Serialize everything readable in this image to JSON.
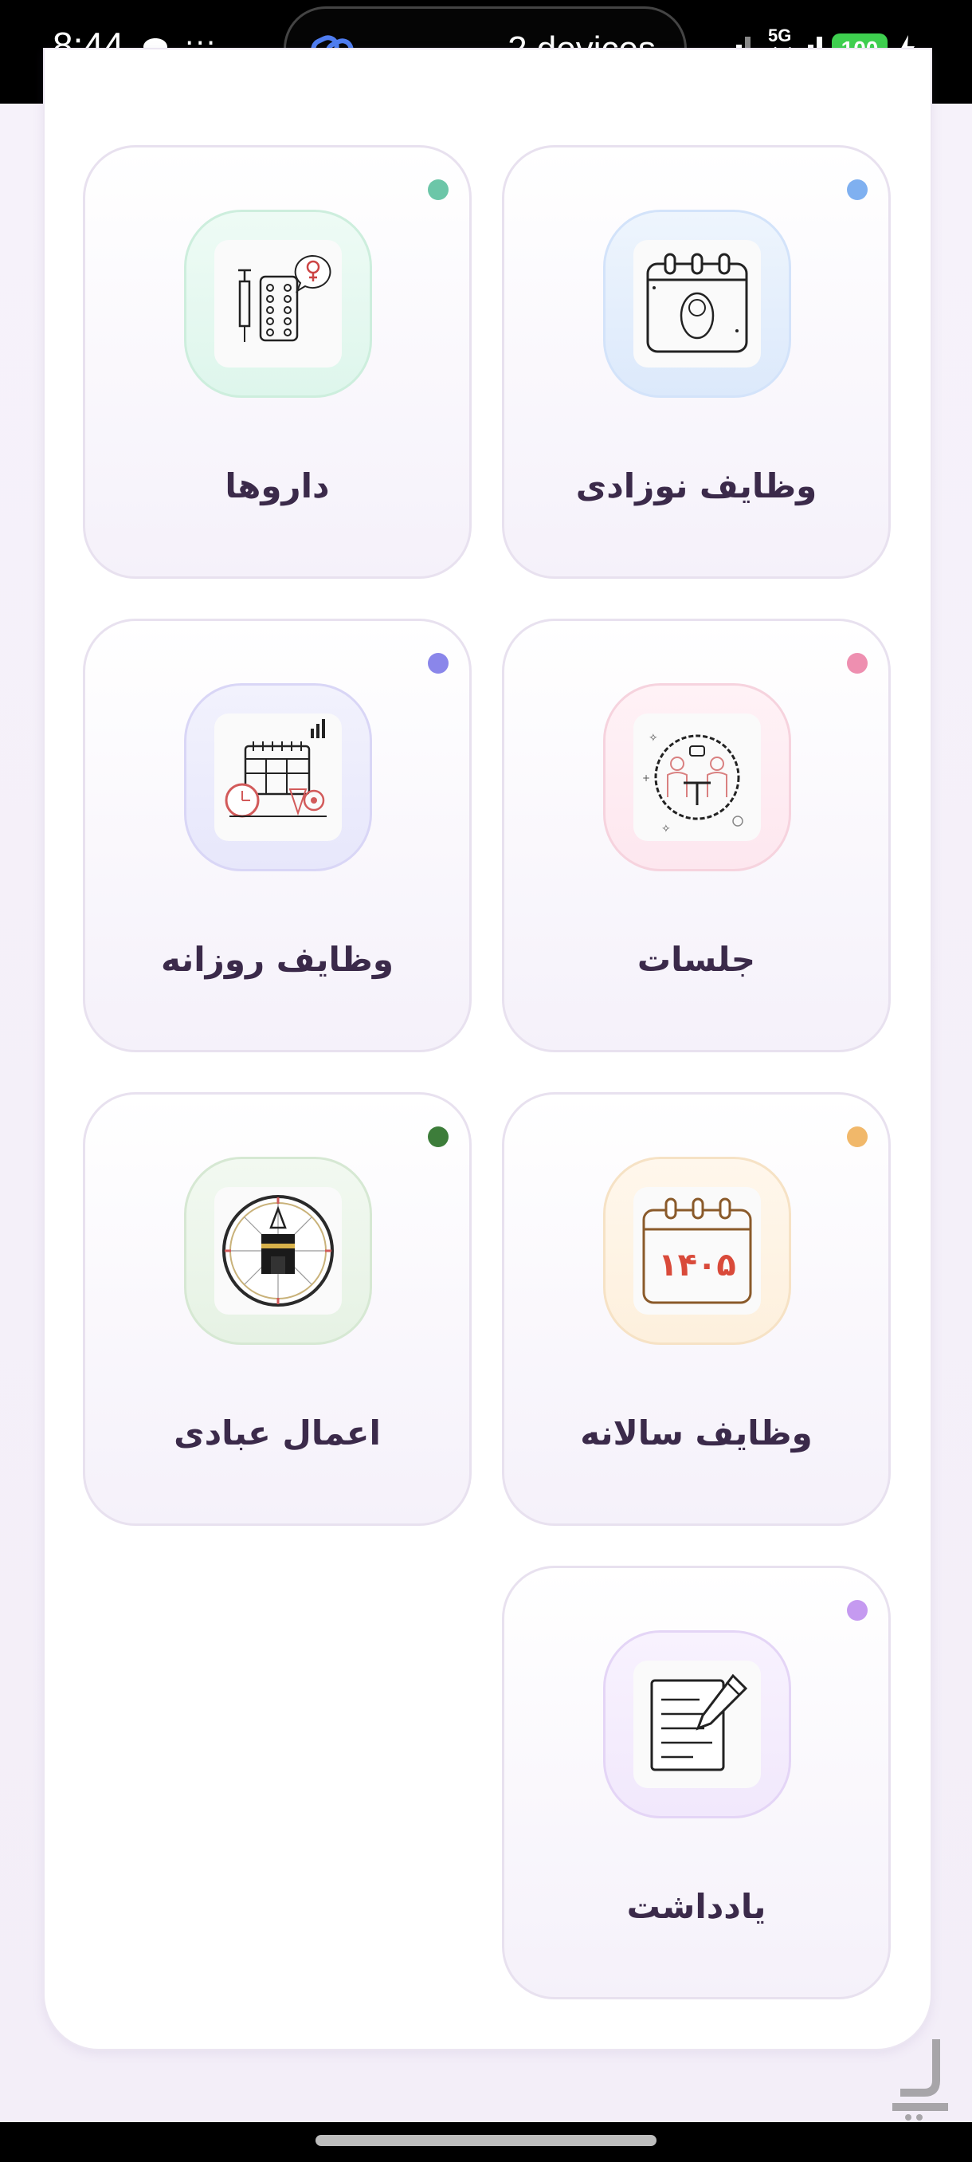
{
  "status_bar": {
    "time": "8:44",
    "more": "···",
    "devices_text": "2 devices",
    "network": "5G",
    "network_arrows": "↑↓",
    "battery": "100",
    "icons": [
      "chat-icon",
      "link-icon",
      "signal-icon",
      "bolt-icon"
    ]
  },
  "tiles": [
    {
      "label": "وظایف نوزادی",
      "dot_color": "#7fb0f0",
      "theme": "#dce9fb",
      "border": "#d3e3fa",
      "icon": "baby-calendar-icon"
    },
    {
      "label": "داروها",
      "dot_color": "#6cc6a8",
      "theme": "#def6ec",
      "border": "#cdeedd",
      "icon": "medicine-icon"
    },
    {
      "label": "جلسات",
      "dot_color": "#ee8fb0",
      "theme": "#fde7ef",
      "border": "#f6d3de",
      "icon": "meeting-icon"
    },
    {
      "label": "وظایف روزانه",
      "dot_color": "#8a86ea",
      "theme": "#e7e7fb",
      "border": "#d9d6f6",
      "icon": "daily-schedule-icon"
    },
    {
      "label": "وظایف سالانه",
      "dot_color": "#f1b86a",
      "theme": "#fdf0dd",
      "border": "#f6e2c5",
      "icon": "yearly-calendar-icon"
    },
    {
      "label": "اعمال عبادی",
      "dot_color": "#3d7d3a",
      "theme": "#e6f2e4",
      "border": "#d6e8d3",
      "icon": "qibla-compass-icon"
    },
    {
      "label": "یادداشت",
      "dot_color": "#c59af0",
      "theme": "#f1e8fc",
      "border": "#e4d5f6",
      "icon": "note-icon"
    }
  ],
  "calendar_year": "۱۴۰۵"
}
